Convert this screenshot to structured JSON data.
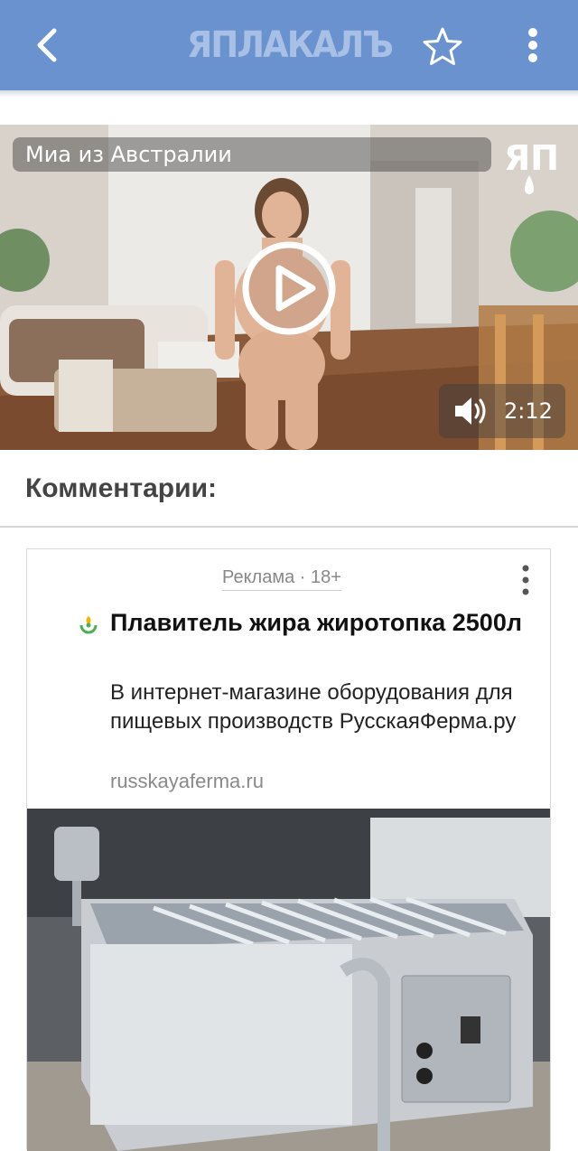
{
  "header": {
    "logo_text": "ЯПЛАКАЛЪ",
    "back_icon": "chevron-left-icon",
    "favorite_icon": "star-outline-icon",
    "menu_icon": "vertical-dots-icon"
  },
  "video": {
    "title": "Миа из Австралии",
    "duration": "2:12",
    "play_icon": "play-circle-icon",
    "volume_icon": "speaker-icon",
    "watermark_icon": "yap-logo-icon"
  },
  "comments": {
    "title": "Комментарии:"
  },
  "ad": {
    "label": "Реклама · 18+",
    "headline": "Плавитель жира жиротопка 2500л",
    "description": "В интернет-магазине оборудования для пищевых производств РусскаяФерма.ру",
    "domain": "russkayaferma.ru"
  },
  "colors": {
    "header_bg": "#6a92cf",
    "logo": "#a9c0e6",
    "text_muted": "#8a8a8a"
  }
}
